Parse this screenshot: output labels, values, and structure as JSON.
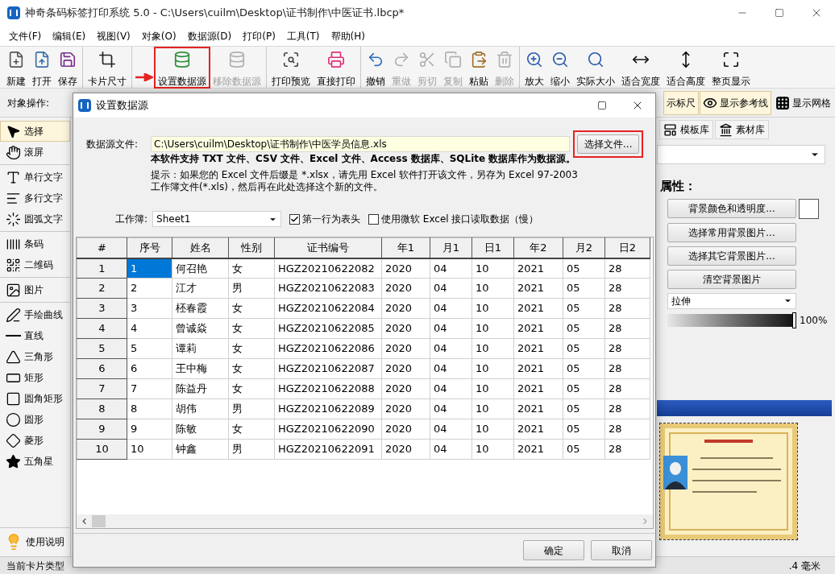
{
  "window": {
    "title": "神奇条码标签打印系统 5.0 - C:\\Users\\cuilm\\Desktop\\证书制作\\中医证书.lbcp*"
  },
  "menu": [
    "文件(F)",
    "编辑(E)",
    "视图(V)",
    "对象(O)",
    "数据源(D)",
    "打印(P)",
    "工具(T)",
    "帮助(H)"
  ],
  "toolbar": [
    [
      {
        "label": "新建",
        "disabled": false,
        "marked": false
      },
      {
        "label": "打开",
        "disabled": false,
        "marked": false
      },
      {
        "label": "保存",
        "disabled": false,
        "marked": false
      }
    ],
    [
      {
        "label": "卡片尺寸",
        "disabled": false,
        "marked": false
      }
    ],
    [
      {
        "label": "设置数据源",
        "disabled": false,
        "marked": true
      },
      {
        "label": "移除数据源",
        "disabled": true,
        "marked": false
      }
    ],
    [
      {
        "label": "打印预览",
        "disabled": false,
        "marked": false
      },
      {
        "label": "直接打印",
        "disabled": false,
        "marked": false
      }
    ],
    [
      {
        "label": "撤销",
        "disabled": false,
        "marked": false
      },
      {
        "label": "重做",
        "disabled": true,
        "marked": false
      },
      {
        "label": "剪切",
        "disabled": true,
        "marked": false
      },
      {
        "label": "复制",
        "disabled": true,
        "marked": false
      },
      {
        "label": "粘贴",
        "disabled": false,
        "marked": false
      },
      {
        "label": "删除",
        "disabled": true,
        "marked": false
      }
    ],
    [
      {
        "label": "放大",
        "disabled": false,
        "marked": false
      },
      {
        "label": "缩小",
        "disabled": false,
        "marked": false
      },
      {
        "label": "实际大小",
        "disabled": false,
        "marked": false
      },
      {
        "label": "适合宽度",
        "disabled": false,
        "marked": false
      },
      {
        "label": "适合高度",
        "disabled": false,
        "marked": false
      },
      {
        "label": "整页显示",
        "disabled": false,
        "marked": false
      }
    ]
  ],
  "object_bar": {
    "label": "对象操作:",
    "toggles": [
      {
        "label": "示标尺",
        "on": true
      },
      {
        "label": "显示参考线",
        "on": true
      },
      {
        "label": "显示网格",
        "on": false
      }
    ]
  },
  "sidebar": {
    "groups": [
      [
        {
          "label": "选择",
          "selected": true
        },
        {
          "label": "滚屏",
          "selected": false
        }
      ],
      [
        {
          "label": "单行文字",
          "selected": false
        },
        {
          "label": "多行文字",
          "selected": false
        },
        {
          "label": "圆弧文字",
          "selected": false
        }
      ],
      [
        {
          "label": "条码",
          "selected": false
        },
        {
          "label": "二维码",
          "selected": false
        }
      ],
      [
        {
          "label": "图片",
          "selected": false
        }
      ],
      [
        {
          "label": "手绘曲线",
          "selected": false
        },
        {
          "label": "直线",
          "selected": false
        },
        {
          "label": "三角形",
          "selected": false
        },
        {
          "label": "矩形",
          "selected": false
        },
        {
          "label": "圆角矩形",
          "selected": false
        },
        {
          "label": "圆形",
          "selected": false
        },
        {
          "label": "菱形",
          "selected": false
        },
        {
          "label": "五角星",
          "selected": false
        }
      ]
    ],
    "help": "使用说明"
  },
  "right_panel": {
    "tabs": [
      "模板库",
      "素材库"
    ],
    "section_title": "属性：",
    "buttons": [
      "背景颜色和透明度...",
      "选择常用背景图片...",
      "选择其它背景图片...",
      "清空背景图片"
    ],
    "stretch_select": "拉伸",
    "opacity": {
      "level": 1,
      "reading": "100%"
    }
  },
  "status_bar": {
    "left": "当前卡片类型",
    "right": ".4 毫米"
  },
  "dialog": {
    "title": "设置数据源",
    "file_label": "数据源文件:",
    "file_value": "C:\\Users\\cuilm\\Desktop\\证书制作\\中医学员信息.xls",
    "choose_button": "选择文件...",
    "choose_marked": true,
    "support_text": "本软件支持 TXT 文件、CSV 文件、Excel 文件、Access 数据库、SQLite 数据库作为数据源。",
    "hint": "提示：如果您的 Excel 文件后缀是 *.xlsx，请先用 Excel 软件打开该文件，另存为 Excel 97-2003 工作簿文件(*.xls)，然后再在此处选择这个新的文件。",
    "workbook_label": "工作簿:",
    "workbook_value": "Sheet1",
    "checkboxes": [
      {
        "label": "第一行为表头",
        "checked": true
      },
      {
        "label": "使用微软 Excel 接口读取数据（慢）",
        "checked": false
      }
    ],
    "table": {
      "row_header_label": "#",
      "columns": [
        "序号",
        "姓名",
        "性别",
        "证书编号",
        "年1",
        "月1",
        "日1",
        "年2",
        "月2",
        "日2"
      ],
      "rows": [
        {
          "number": "1",
          "cells": [
            {
              "text": "1",
              "selected": true
            },
            {
              "text": "何召艳",
              "selected": false
            },
            {
              "text": "女",
              "selected": false
            },
            {
              "text": "HGZ20210622082",
              "selected": false
            },
            {
              "text": "2020",
              "selected": false
            },
            {
              "text": "04",
              "selected": false
            },
            {
              "text": "10",
              "selected": false
            },
            {
              "text": "2021",
              "selected": false
            },
            {
              "text": "05",
              "selected": false
            },
            {
              "text": "28",
              "selected": false
            }
          ]
        },
        {
          "number": "2",
          "cells": [
            {
              "text": "2",
              "selected": false
            },
            {
              "text": "江才",
              "selected": false
            },
            {
              "text": "男",
              "selected": false
            },
            {
              "text": "HGZ20210622083",
              "selected": false
            },
            {
              "text": "2020",
              "selected": false
            },
            {
              "text": "04",
              "selected": false
            },
            {
              "text": "10",
              "selected": false
            },
            {
              "text": "2021",
              "selected": false
            },
            {
              "text": "05",
              "selected": false
            },
            {
              "text": "28",
              "selected": false
            }
          ]
        },
        {
          "number": "3",
          "cells": [
            {
              "text": "3",
              "selected": false
            },
            {
              "text": "柸春霞",
              "selected": false
            },
            {
              "text": "女",
              "selected": false
            },
            {
              "text": "HGZ20210622084",
              "selected": false
            },
            {
              "text": "2020",
              "selected": false
            },
            {
              "text": "04",
              "selected": false
            },
            {
              "text": "10",
              "selected": false
            },
            {
              "text": "2021",
              "selected": false
            },
            {
              "text": "05",
              "selected": false
            },
            {
              "text": "28",
              "selected": false
            }
          ]
        },
        {
          "number": "4",
          "cells": [
            {
              "text": "4",
              "selected": false
            },
            {
              "text": "曾诚焱",
              "selected": false
            },
            {
              "text": "女",
              "selected": false
            },
            {
              "text": "HGZ20210622085",
              "selected": false
            },
            {
              "text": "2020",
              "selected": false
            },
            {
              "text": "04",
              "selected": false
            },
            {
              "text": "10",
              "selected": false
            },
            {
              "text": "2021",
              "selected": false
            },
            {
              "text": "05",
              "selected": false
            },
            {
              "text": "28",
              "selected": false
            }
          ]
        },
        {
          "number": "5",
          "cells": [
            {
              "text": "5",
              "selected": false
            },
            {
              "text": "谭莉",
              "selected": false
            },
            {
              "text": "女",
              "selected": false
            },
            {
              "text": "HGZ20210622086",
              "selected": false
            },
            {
              "text": "2020",
              "selected": false
            },
            {
              "text": "04",
              "selected": false
            },
            {
              "text": "10",
              "selected": false
            },
            {
              "text": "2021",
              "selected": false
            },
            {
              "text": "05",
              "selected": false
            },
            {
              "text": "28",
              "selected": false
            }
          ]
        },
        {
          "number": "6",
          "cells": [
            {
              "text": "6",
              "selected": false
            },
            {
              "text": "王中梅",
              "selected": false
            },
            {
              "text": "女",
              "selected": false
            },
            {
              "text": "HGZ20210622087",
              "selected": false
            },
            {
              "text": "2020",
              "selected": false
            },
            {
              "text": "04",
              "selected": false
            },
            {
              "text": "10",
              "selected": false
            },
            {
              "text": "2021",
              "selected": false
            },
            {
              "text": "05",
              "selected": false
            },
            {
              "text": "28",
              "selected": false
            }
          ]
        },
        {
          "number": "7",
          "cells": [
            {
              "text": "7",
              "selected": false
            },
            {
              "text": "陈益丹",
              "selected": false
            },
            {
              "text": "女",
              "selected": false
            },
            {
              "text": "HGZ20210622088",
              "selected": false
            },
            {
              "text": "2020",
              "selected": false
            },
            {
              "text": "04",
              "selected": false
            },
            {
              "text": "10",
              "selected": false
            },
            {
              "text": "2021",
              "selected": false
            },
            {
              "text": "05",
              "selected": false
            },
            {
              "text": "28",
              "selected": false
            }
          ]
        },
        {
          "number": "8",
          "cells": [
            {
              "text": "8",
              "selected": false
            },
            {
              "text": "胡伟",
              "selected": false
            },
            {
              "text": "男",
              "selected": false
            },
            {
              "text": "HGZ20210622089",
              "selected": false
            },
            {
              "text": "2020",
              "selected": false
            },
            {
              "text": "04",
              "selected": false
            },
            {
              "text": "10",
              "selected": false
            },
            {
              "text": "2021",
              "selected": false
            },
            {
              "text": "05",
              "selected": false
            },
            {
              "text": "28",
              "selected": false
            }
          ]
        },
        {
          "number": "9",
          "cells": [
            {
              "text": "9",
              "selected": false
            },
            {
              "text": "陈敏",
              "selected": false
            },
            {
              "text": "女",
              "selected": false
            },
            {
              "text": "HGZ20210622090",
              "selected": false
            },
            {
              "text": "2020",
              "selected": false
            },
            {
              "text": "04",
              "selected": false
            },
            {
              "text": "10",
              "selected": false
            },
            {
              "text": "2021",
              "selected": false
            },
            {
              "text": "05",
              "selected": false
            },
            {
              "text": "28",
              "selected": false
            }
          ]
        },
        {
          "number": "10",
          "cells": [
            {
              "text": "10",
              "selected": false
            },
            {
              "text": "钟鑫",
              "selected": false
            },
            {
              "text": "男",
              "selected": false
            },
            {
              "text": "HGZ20210622091",
              "selected": false
            },
            {
              "text": "2020",
              "selected": false
            },
            {
              "text": "04",
              "selected": false
            },
            {
              "text": "10",
              "selected": false
            },
            {
              "text": "2021",
              "selected": false
            },
            {
              "text": "05",
              "selected": false
            },
            {
              "text": "28",
              "selected": false
            }
          ]
        }
      ]
    },
    "buttons": [
      "确定",
      "取消"
    ]
  }
}
